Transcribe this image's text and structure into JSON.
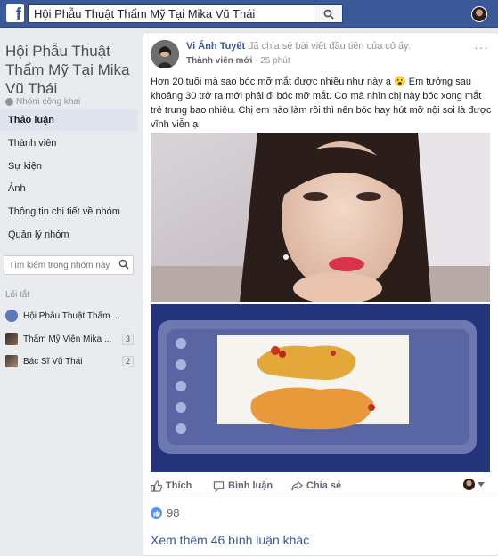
{
  "topbar": {
    "logo": "f",
    "search_value": "Hội Phẫu Thuật Thẩm Mỹ Tại Mika Vũ Thái"
  },
  "sidebar": {
    "group_name": "Hội Phẫu Thuật Thẩm Mỹ Tại Mika Vũ Thái",
    "privacy": "Nhóm công khai",
    "nav": [
      {
        "label": "Thảo luận",
        "active": true
      },
      {
        "label": "Thành viên"
      },
      {
        "label": "Sự kiện"
      },
      {
        "label": "Ảnh"
      },
      {
        "label": "Thông tin chi tiết về nhóm"
      },
      {
        "label": "Quản lý nhóm"
      }
    ],
    "search_placeholder": "Tìm kiếm trong nhóm này",
    "shortcuts_title": "Lối tắt",
    "shortcuts": [
      {
        "label": "Hội Phẫu Thuật Thẩm ...",
        "count": ""
      },
      {
        "label": "Thẩm Mỹ Viện Mika ...",
        "count": "3"
      },
      {
        "label": "Bác Sĩ Vũ Thái",
        "count": "2"
      }
    ]
  },
  "post": {
    "author": "Vi Ánh Tuyết",
    "action": " đã chia sẻ bài viết đầu tiên của cô ấy.",
    "badge": "Thành viên mới",
    "separator": " · ",
    "time": "25 phút",
    "text": "Hơn 20 tuổi mà sao bóc mỡ mắt được nhiều như này ạ 😮 Em tưởng sau khoảng 30 trở ra mới phải đi bóc mỡ mắt. Cơ mà nhìn chị này bóc xong mắt trẻ trung bao nhiêu. Chị em nào làm rồi thì nên bóc hay hút mỡ nội soi là được vĩnh viễn ạ",
    "actions": {
      "like": "Thích",
      "comment": "Bình luận",
      "share": "Chia sẻ"
    },
    "reaction_count": "98",
    "more_comments": "Xem thêm 46 bình luận khác"
  },
  "colors": {
    "brand": "#3b5998",
    "link": "#365899",
    "like": "#5890ff"
  }
}
